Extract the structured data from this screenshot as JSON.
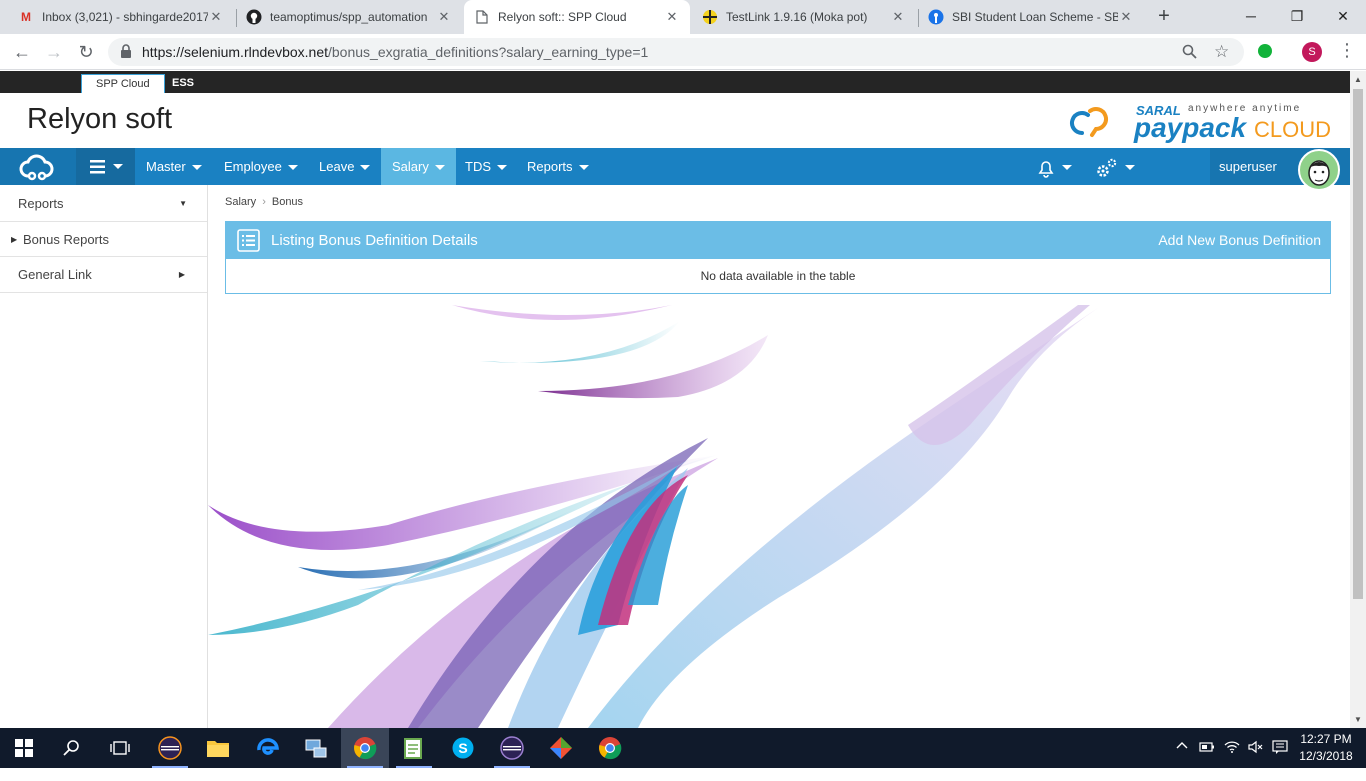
{
  "browser": {
    "tabs": [
      {
        "title": "Inbox (3,021) - sbhingarde2017",
        "icon": "gmail-icon",
        "active": false
      },
      {
        "title": "teamoptimus/spp_automation",
        "icon": "github-icon",
        "active": false
      },
      {
        "title": "Relyon soft:: SPP Cloud",
        "icon": "page-icon",
        "active": true
      },
      {
        "title": "TestLink 1.9.16 (Moka pot)",
        "icon": "testlink-icon",
        "active": false
      },
      {
        "title": "SBI Student Loan Scheme - SBI",
        "icon": "sbi-icon",
        "active": false
      }
    ],
    "url_host": "https://selenium.rlndevbox.net",
    "url_path": "/bonus_exgratia_definitions?salary_earning_type=1",
    "profile_initial": "S"
  },
  "topbar": {
    "items": [
      "SPP Cloud",
      "ESS"
    ]
  },
  "header": {
    "brand": "Relyon soft",
    "logo_top": "SARAL",
    "logo_tagline": "anywhere anytime",
    "logo_pay": "paypack",
    "logo_cloud": "CLOUD"
  },
  "nav": {
    "items": [
      "Master",
      "Employee",
      "Leave",
      "Salary",
      "TDS",
      "Reports"
    ],
    "active": "Salary",
    "username": "superuser"
  },
  "sidebar": {
    "items": [
      "Reports",
      "Bonus Reports",
      "General Link"
    ]
  },
  "breadcrumb": [
    "Salary",
    "Bonus"
  ],
  "panel": {
    "title": "Listing Bonus Definition Details",
    "add_link": "Add New Bonus Definition",
    "empty_message": "No data available in the table"
  },
  "taskbar": {
    "time": "12:27 PM",
    "date": "12/3/2018"
  },
  "colors": {
    "nav_bg": "#1a81c2",
    "nav_active": "#5bb7e2",
    "panel_head": "#6bbde6",
    "topbar": "#252525"
  }
}
